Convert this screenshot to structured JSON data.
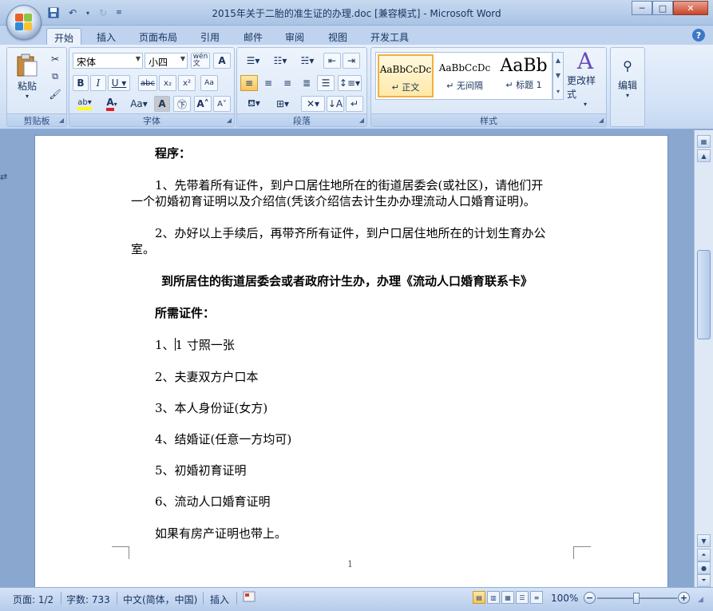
{
  "window": {
    "title": "2015年关于二胎的准生证的办理.doc [兼容模式] - Microsoft Word",
    "minimize": "─",
    "maximize": "□",
    "close": "✕"
  },
  "tabs": [
    "开始",
    "插入",
    "页面布局",
    "引用",
    "邮件",
    "审阅",
    "视图",
    "开发工具"
  ],
  "ribbon": {
    "clipboard": {
      "label": "剪贴板",
      "paste": "粘贴"
    },
    "font": {
      "label": "字体",
      "font_name": "宋体",
      "font_size": "小四",
      "wen": "wén\n文"
    },
    "paragraph": {
      "label": "段落"
    },
    "styles": {
      "label": "样式",
      "items": [
        {
          "sample": "AaBbCcDc",
          "name": "↵ 正文"
        },
        {
          "sample": "AaBbCcDc",
          "name": "↵ 无间隔"
        },
        {
          "sample": "AaBb",
          "name": "↵ 标题 1"
        }
      ],
      "change_styles": "更改样式"
    },
    "editing": {
      "label": "编辑"
    }
  },
  "document": {
    "line1": "程序：",
    "line2a": "1、先带着所有证件，到户口居住地所在的街道居委会(或社区)，请他们开",
    "line2b": "一个初婚初育证明以及介绍信(凭该介绍信去计生办办理流动人口婚育证明)。",
    "line3a": "2、办好以上手续后，再带齐所有证件，到户口居住地所在的计划生育办公",
    "line3b": "室。",
    "heading": "到所居住的街道居委会或者政府计生办，办理《流动人口婚育联系卡》",
    "needs": "所需证件：",
    "item1_prefix": "1、",
    "item1_rest": "1 寸照一张",
    "item2": "2、夫妻双方户口本",
    "item3": "3、本人身份证(女方)",
    "item4": "4、结婚证(任意一方均可)",
    "item5": "5、初婚初育证明",
    "item6": "6、流动人口婚育证明",
    "last": "如果有房产证明也带上。",
    "page_number": "1"
  },
  "status": {
    "page": "页面: 1/2",
    "words": "字数: 733",
    "lang": "中文(简体，中国)",
    "mode": "插入",
    "zoom": "100%",
    "zoom_value": 100
  },
  "colors": {
    "highlight": "#ffff00",
    "font_color": "#e02020",
    "accent": "#3d78c6"
  }
}
